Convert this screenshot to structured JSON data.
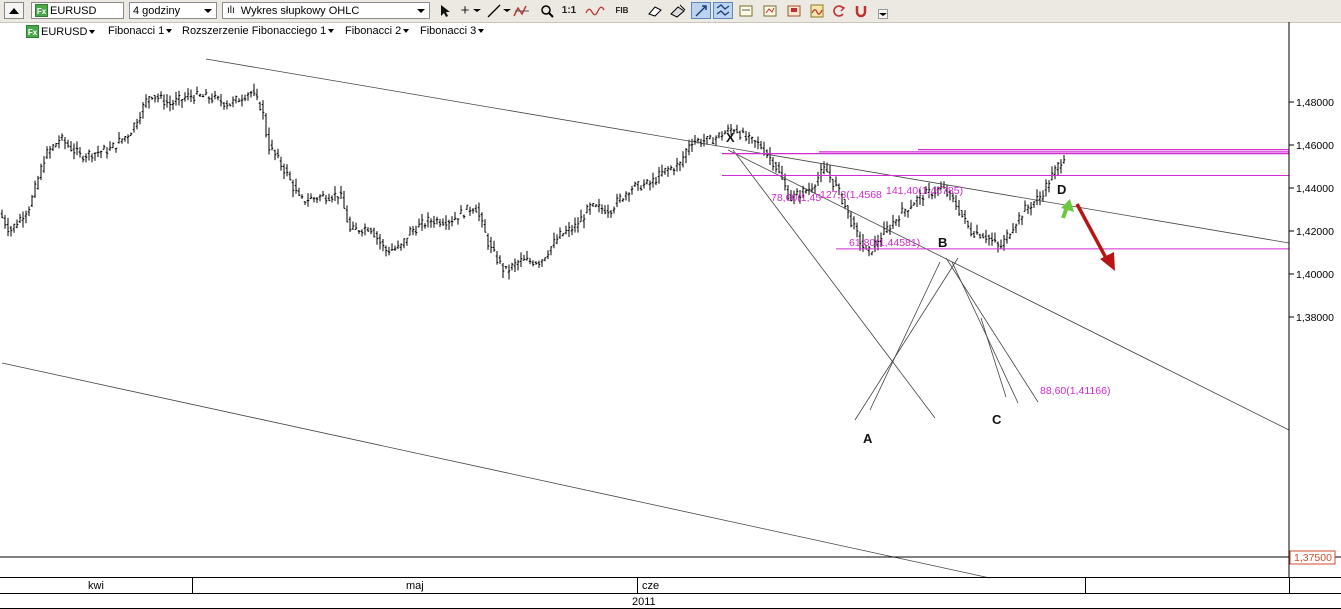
{
  "toolbar": {
    "symbol": "EURUSD",
    "interval": "4 godziny",
    "chart_type": "Wykres słupkowy OHLC",
    "tool_icons": [
      "cursor-icon",
      "crosshair-icon",
      "dropdown-icon",
      "trendline-icon",
      "zoom-icon",
      "one-to-one-icon",
      "indicator-icon",
      "fib-icon",
      "eraser-icon",
      "draw-icon",
      "autoscale-icon",
      "multi-icon",
      "template-icon",
      "template2-icon",
      "save-template-icon",
      "wave-icon",
      "cycle-icon",
      "magnet-icon"
    ],
    "one_to_one": "1:1",
    "fib": "FIB"
  },
  "studies": [
    "EURUSD",
    "Fibonacci 1",
    "Rozszerzenie Fibonacciego 1",
    "Fibonacci 2",
    "Fibonacci 3"
  ],
  "price_axis": {
    "ticks": [
      "1,48000",
      "1,46000",
      "1,44000",
      "1,42000",
      "1,40000",
      "1,38000"
    ],
    "current": "1,37500"
  },
  "time_axis": {
    "months": [
      "kwi",
      "maj",
      "cze"
    ],
    "year": "2011"
  },
  "pattern_labels": {
    "x": "X",
    "a": "A",
    "b": "B",
    "c": "C",
    "d": "D"
  },
  "fib_levels": [
    "78,60(1,45",
    "127,3(1,4568",
    "141,40(1,45785)",
    "61,80(1,44581)",
    "88,60(1,41166)"
  ],
  "colors": {
    "fib": "#d22ad2",
    "trend": "#444444",
    "up_arrow": "#6bc93e",
    "down_arrow": "#b81414",
    "accent": "#d14a2a"
  },
  "chart_data": {
    "type": "ohlc",
    "symbol": "EURUSD",
    "x": [
      "kwi",
      "maj",
      "cze"
    ],
    "ylim": [
      1.37,
      1.495
    ],
    "close_path": [
      [
        0,
        1.428
      ],
      [
        10,
        1.42
      ],
      [
        30,
        1.432
      ],
      [
        45,
        1.455
      ],
      [
        60,
        1.463
      ],
      [
        80,
        1.455
      ],
      [
        110,
        1.458
      ],
      [
        130,
        1.466
      ],
      [
        150,
        1.484
      ],
      [
        170,
        1.479
      ],
      [
        190,
        1.483
      ],
      [
        210,
        1.482
      ],
      [
        230,
        1.479
      ],
      [
        250,
        1.485
      ],
      [
        262,
        1.477
      ],
      [
        268,
        1.46
      ],
      [
        285,
        1.448
      ],
      [
        300,
        1.434
      ],
      [
        320,
        1.436
      ],
      [
        340,
        1.437
      ],
      [
        350,
        1.42
      ],
      [
        370,
        1.422
      ],
      [
        385,
        1.411
      ],
      [
        400,
        1.412
      ],
      [
        410,
        1.42
      ],
      [
        430,
        1.425
      ],
      [
        450,
        1.425
      ],
      [
        475,
        1.432
      ],
      [
        490,
        1.412
      ],
      [
        505,
        1.401
      ],
      [
        520,
        1.406
      ],
      [
        540,
        1.406
      ],
      [
        560,
        1.418
      ],
      [
        575,
        1.422
      ],
      [
        590,
        1.431
      ],
      [
        610,
        1.43
      ],
      [
        630,
        1.44
      ],
      [
        650,
        1.442
      ],
      [
        665,
        1.448
      ],
      [
        680,
        1.451
      ],
      [
        690,
        1.462
      ],
      [
        710,
        1.462
      ],
      [
        725,
        1.466
      ],
      [
        735,
        1.468
      ],
      [
        745,
        1.463
      ],
      [
        760,
        1.46
      ],
      [
        775,
        1.451
      ],
      [
        790,
        1.435
      ],
      [
        810,
        1.44
      ],
      [
        825,
        1.449
      ],
      [
        840,
        1.437
      ],
      [
        855,
        1.42
      ],
      [
        867,
        1.409
      ],
      [
        880,
        1.417
      ],
      [
        900,
        1.428
      ],
      [
        920,
        1.436
      ],
      [
        942,
        1.44
      ],
      [
        955,
        1.433
      ],
      [
        970,
        1.42
      ],
      [
        985,
        1.418
      ],
      [
        1000,
        1.412
      ],
      [
        1012,
        1.422
      ],
      [
        1025,
        1.43
      ],
      [
        1040,
        1.436
      ],
      [
        1050,
        1.444
      ],
      [
        1065,
        1.456
      ]
    ],
    "fibonacci": [
      {
        "label": "78,60(1,45",
        "value": 1.456
      },
      {
        "label": "127,3(1,4568",
        "value": 1.4568
      },
      {
        "label": "141,40(1,45785)",
        "value": 1.45785
      },
      {
        "label": "61,80(1,44581)",
        "value": 1.44581
      },
      {
        "label": "88,60(1,41166)",
        "value": 1.41166
      }
    ],
    "points": {
      "X": 1.4695,
      "A": 1.4085,
      "B": 1.4445,
      "C": 1.4115,
      "D": 1.4575
    }
  }
}
